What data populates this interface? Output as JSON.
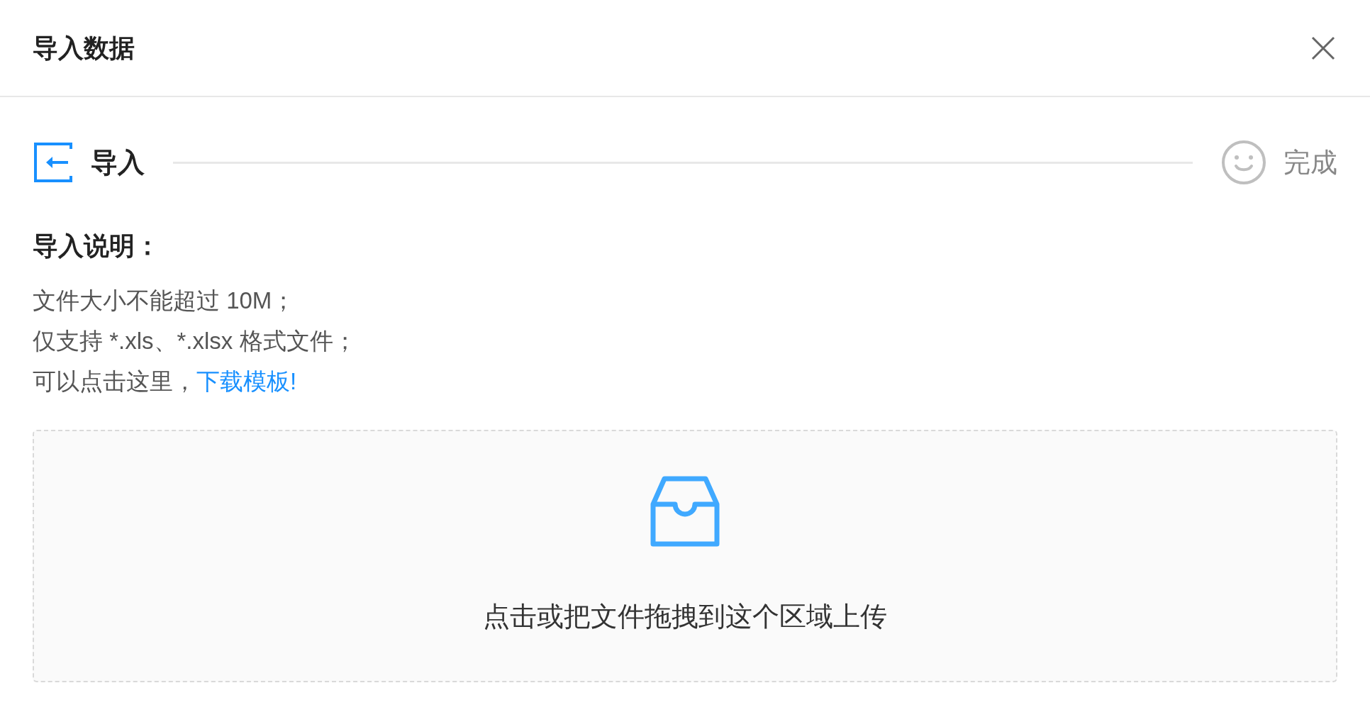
{
  "dialog": {
    "title": "导入数据"
  },
  "steps": [
    {
      "kind": "import",
      "label": "导入",
      "selected": true
    },
    {
      "kind": "done",
      "label": "完成",
      "selected": false
    }
  ],
  "instructions": {
    "heading": "导入说明：",
    "lines": [
      {
        "text": "文件大小不能超过 10M；"
      },
      {
        "text": "仅支持 *.xls、*.xlsx 格式文件；"
      },
      {
        "text": "可以点击这里，",
        "link": "下载模板!"
      }
    ]
  },
  "upload": {
    "hint": "点击或把文件拖拽到这个区域上传"
  }
}
